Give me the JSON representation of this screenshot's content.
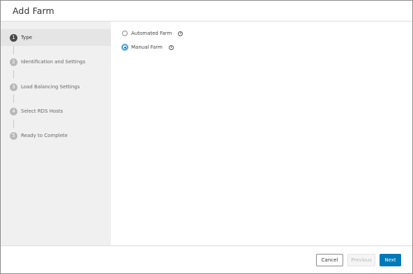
{
  "dialog": {
    "title": "Add Farm"
  },
  "steps": [
    {
      "number": "1",
      "label": "Type",
      "active": true
    },
    {
      "number": "2",
      "label": "Identification and Settings",
      "active": false
    },
    {
      "number": "3",
      "label": "Load Balancing Settings",
      "active": false
    },
    {
      "number": "4",
      "label": "Select RDS Hosts",
      "active": false
    },
    {
      "number": "5",
      "label": "Ready to Complete",
      "active": false
    }
  ],
  "farm_type": {
    "options": [
      {
        "label": "Automated Farm",
        "checked": false,
        "info_icon": "info-icon"
      },
      {
        "label": "Manual Farm",
        "checked": true,
        "info_icon": "info-icon"
      }
    ],
    "info_glyph": "i"
  },
  "footer": {
    "cancel_label": "Cancel",
    "previous_label": "Previous",
    "next_label": "Next"
  },
  "colors": {
    "accent": "#0079b8",
    "sidebar_bg": "#f0f0f0",
    "active_step_bg": "#e5e5e5"
  }
}
